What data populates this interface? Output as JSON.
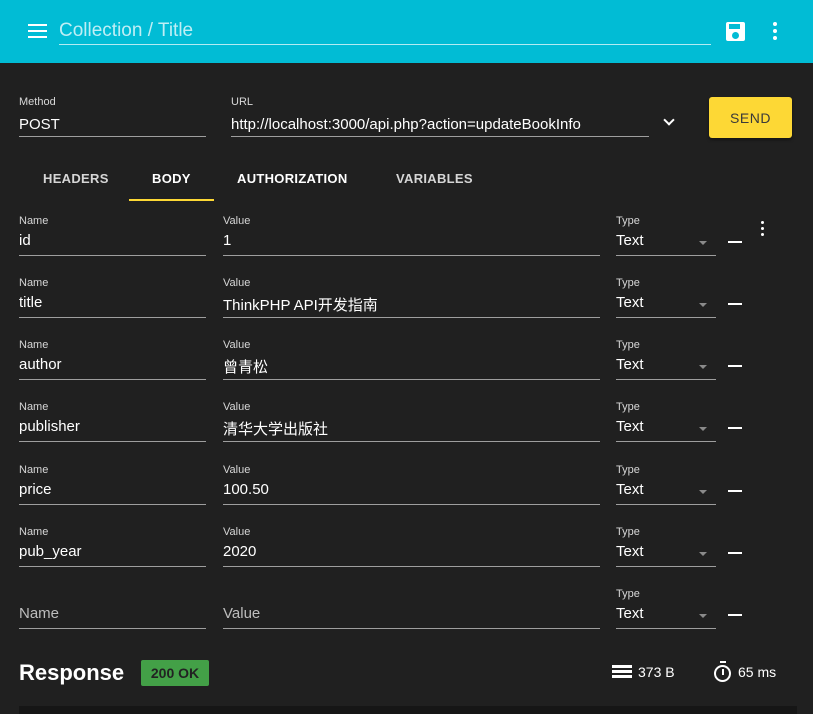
{
  "appbar": {
    "title_placeholder": "Collection / Title",
    "save_icon": "floppy-disk-icon",
    "more_icon": "kebab-menu-icon"
  },
  "request": {
    "method_label": "Method",
    "method_value": "POST",
    "url_label": "URL",
    "url_value": "http://localhost:3000/api.php?action=updateBookInfo",
    "send_label": "SEND"
  },
  "tabs": [
    {
      "label": "HEADERS"
    },
    {
      "label": "BODY"
    },
    {
      "label": "AUTHORIZATION"
    },
    {
      "label": "VARIABLES"
    }
  ],
  "params": {
    "name_label": "Name",
    "value_label": "Value",
    "type_label": "Type",
    "rows": [
      {
        "name": "id",
        "value": "1",
        "type": "Text"
      },
      {
        "name": "title",
        "value": "ThinkPHP API开发指南",
        "type": "Text"
      },
      {
        "name": "author",
        "value": "曾青松",
        "type": "Text"
      },
      {
        "name": "publisher",
        "value": "清华大学出版社",
        "type": "Text"
      },
      {
        "name": "price",
        "value": "100.50",
        "type": "Text"
      },
      {
        "name": "pub_year",
        "value": "2020",
        "type": "Text"
      }
    ],
    "empty_row": {
      "name_placeholder": "Name",
      "value_placeholder": "Value",
      "type": "Text"
    }
  },
  "response": {
    "title": "Response",
    "status": "200 OK",
    "size": "373 B",
    "time": "65 ms"
  },
  "colors": {
    "appbar": "#01bcd5",
    "accent": "#fdd835",
    "status_ok": "#43a047",
    "background": "#202020"
  }
}
